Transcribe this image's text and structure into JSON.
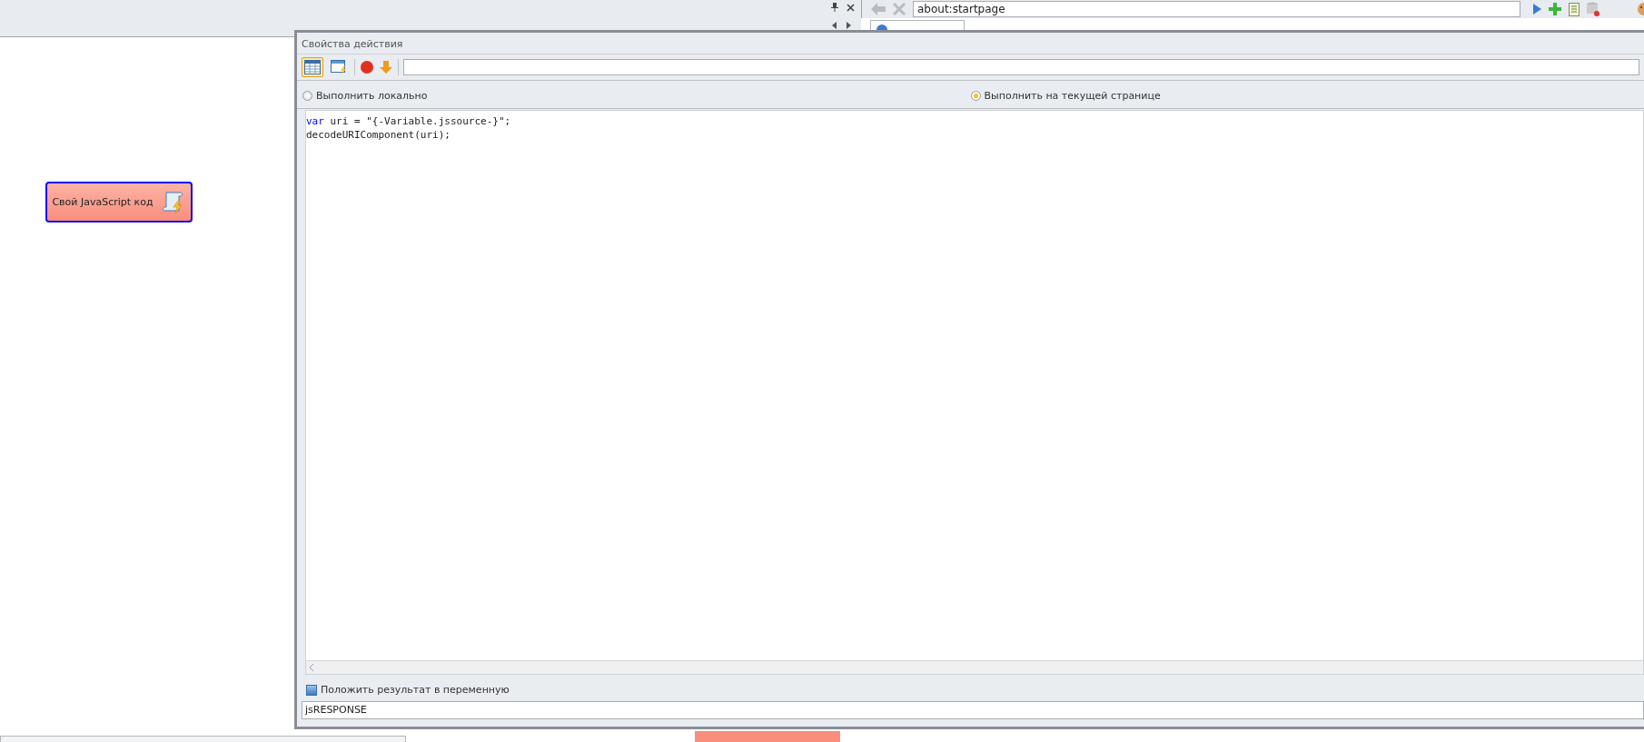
{
  "browser": {
    "address": "about:startpage"
  },
  "canvas": {
    "node": {
      "label": "Свой JavaScript код",
      "selected": true
    }
  },
  "dialog": {
    "title": "Свойства действия",
    "run_mode": [
      {
        "label": "Выполнить локально",
        "selected": false
      },
      {
        "label": "Выполнить на текущей странице",
        "selected": true
      }
    ],
    "code_lines": [
      [
        {
          "kind": "keyword",
          "text": "var"
        },
        {
          "kind": "plain",
          "text": " uri = \"{-Variable.jssource-}\";"
        }
      ],
      [
        {
          "kind": "plain",
          "text": "decodeURIComponent(uri);"
        }
      ]
    ],
    "save_result": {
      "label": "Положить результат в переменную",
      "checked": true
    },
    "variable": "jsRESPONSE"
  }
}
